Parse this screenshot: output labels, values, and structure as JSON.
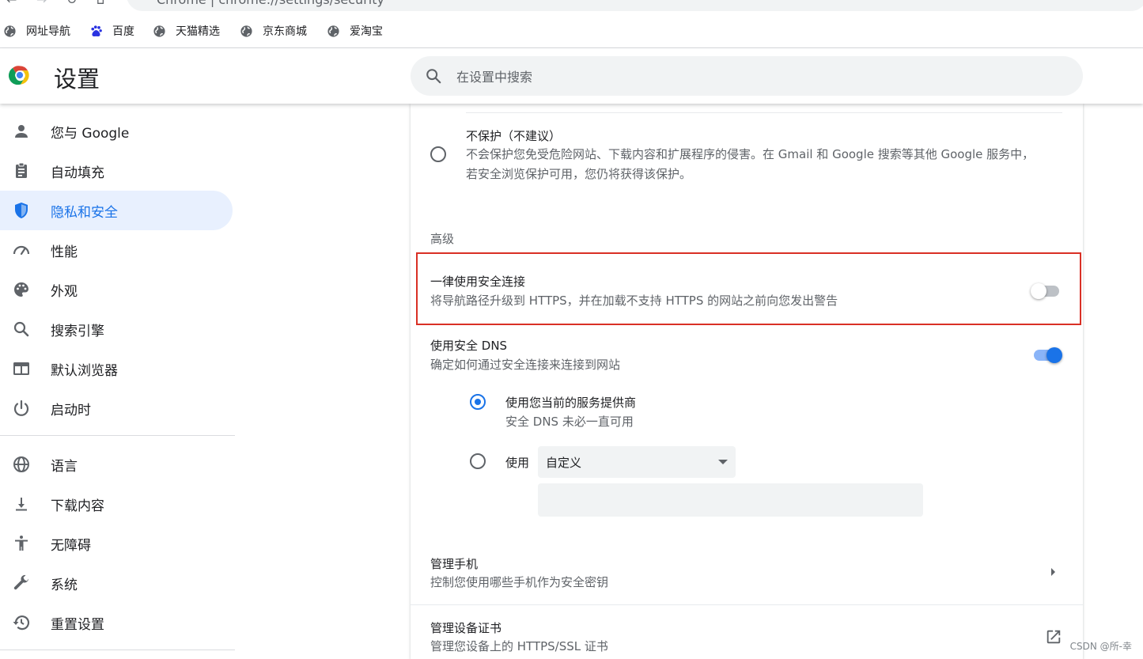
{
  "browser": {
    "address_prefix": "Chrome",
    "address_url": "chrome://settings/security"
  },
  "bookmarks": [
    {
      "label": "网址导航",
      "icon": "globe-icon"
    },
    {
      "label": "百度",
      "icon": "baidu-paw-icon"
    },
    {
      "label": "天猫精选",
      "icon": "globe-icon"
    },
    {
      "label": "京东商城",
      "icon": "globe-icon"
    },
    {
      "label": "爱淘宝",
      "icon": "globe-icon"
    }
  ],
  "header": {
    "title": "设置",
    "search_placeholder": "在设置中搜索"
  },
  "sidebar": {
    "items": [
      {
        "label": "您与 Google",
        "icon": "person-icon"
      },
      {
        "label": "自动填充",
        "icon": "clipboard-icon"
      },
      {
        "label": "隐私和安全",
        "icon": "shield-icon",
        "active": true
      },
      {
        "label": "性能",
        "icon": "gauge-icon"
      },
      {
        "label": "外观",
        "icon": "palette-icon"
      },
      {
        "label": "搜索引擎",
        "icon": "search-icon"
      },
      {
        "label": "默认浏览器",
        "icon": "browser-window-icon"
      },
      {
        "label": "启动时",
        "icon": "power-icon"
      },
      {
        "label": "语言",
        "icon": "globe-icon"
      },
      {
        "label": "下载内容",
        "icon": "download-icon"
      },
      {
        "label": "无障碍",
        "icon": "accessibility-icon"
      },
      {
        "label": "系统",
        "icon": "wrench-icon"
      },
      {
        "label": "重置设置",
        "icon": "restore-icon"
      }
    ]
  },
  "main": {
    "no_protection": {
      "title": "不保护（不建议）",
      "desc_line1": "不会保护您免受危险网站、下载内容和扩展程序的侵害。在 Gmail 和 Google 搜索等其他 Google 服务中，",
      "desc_line2": "若安全浏览保护可用，您仍将获得该保护。"
    },
    "advanced_label": "高级",
    "https_only": {
      "title": "一律使用安全连接",
      "desc": "将导航路径升级到 HTTPS，并在加载不支持 HTTPS 的网站之前向您发出警告",
      "enabled": false
    },
    "secure_dns": {
      "title": "使用安全 DNS",
      "desc": "确定如何通过安全连接来连接到网站",
      "enabled": true,
      "option_current": {
        "title": "使用您当前的服务提供商",
        "desc": "安全 DNS 未必一直可用",
        "selected": true
      },
      "option_custom": {
        "label": "使用",
        "select_value": "自定义",
        "selected": false
      }
    },
    "manage_phones": {
      "title": "管理手机",
      "desc": "控制您使用哪些手机作为安全密钥"
    },
    "manage_certs": {
      "title": "管理设备证书",
      "desc": "管理您设备上的 HTTPS/SSL 证书"
    }
  },
  "watermark": "CSDN @所-幸",
  "colors": {
    "accent": "#1a73e8",
    "highlight_border": "#d93025",
    "active_nav_bg": "#e8f0fe"
  }
}
